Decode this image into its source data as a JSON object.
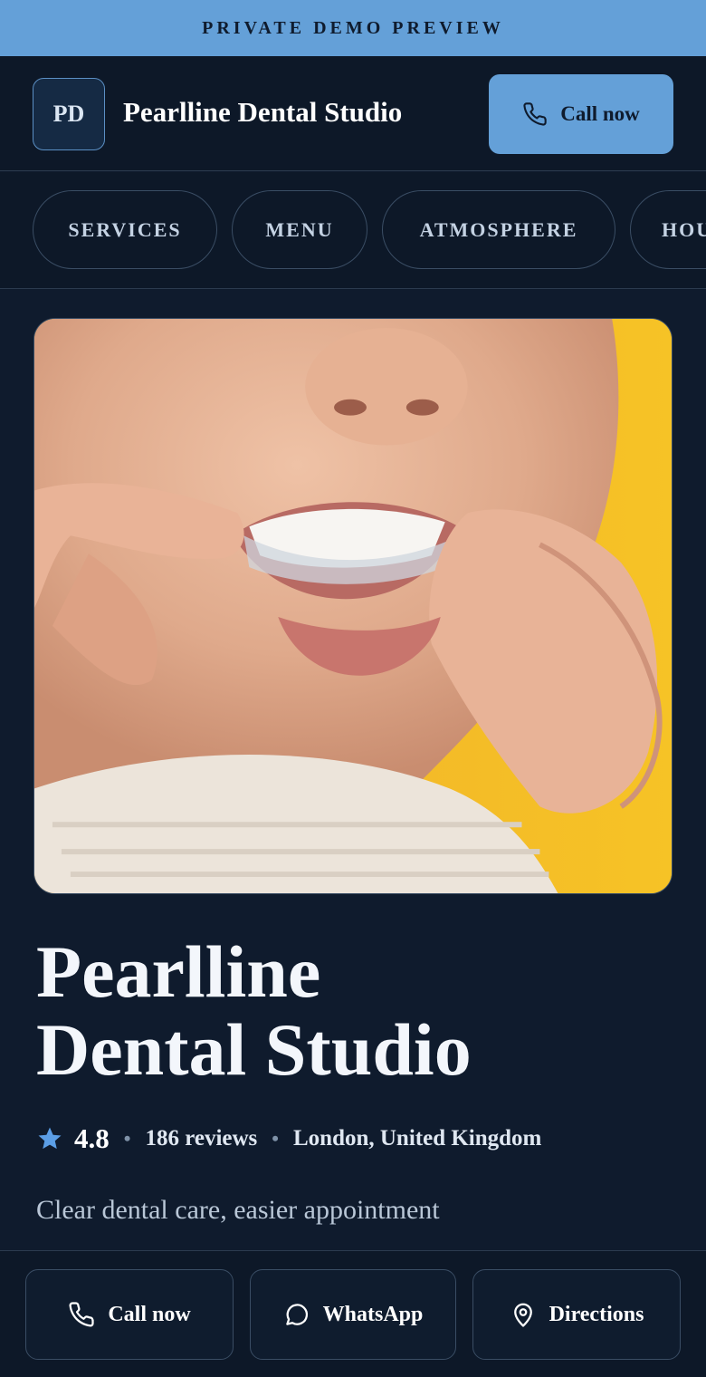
{
  "banner": {
    "text": "PRIVATE DEMO PREVIEW"
  },
  "header": {
    "logo_initials": "PD",
    "brand_name": "Pearlline Dental Studio",
    "call_label": "Call now"
  },
  "nav": {
    "items": [
      {
        "label": "SERVICES"
      },
      {
        "label": "MENU"
      },
      {
        "label": "ATMOSPHERE"
      },
      {
        "label": "HOURS"
      }
    ]
  },
  "hero": {
    "image_icon": "dental-aligner-photo"
  },
  "business": {
    "title_line1": "Pearlline",
    "title_line2": "Dental Studio",
    "rating": "4.8",
    "reviews": "186 reviews",
    "location": "London, United Kingdom",
    "tagline": "Clear dental care, easier appointment"
  },
  "actions": {
    "call_label": "Call now",
    "whatsapp_label": "WhatsApp",
    "directions_label": "Directions"
  },
  "colors": {
    "accent": "#64a0d8",
    "background": "#0f1b2d",
    "star": "#5b9ee6"
  }
}
